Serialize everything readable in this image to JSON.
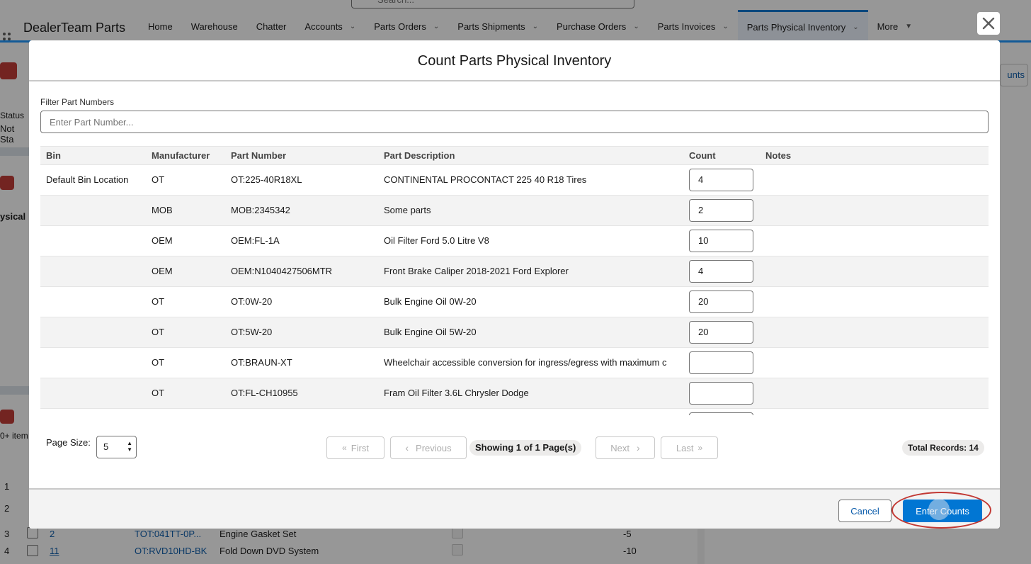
{
  "app": {
    "search_placeholder": "Search...",
    "name": "DealerTeam Parts",
    "nav": [
      {
        "label": "Home",
        "dropdown": false
      },
      {
        "label": "Warehouse",
        "dropdown": false
      },
      {
        "label": "Chatter",
        "dropdown": false
      },
      {
        "label": "Accounts",
        "dropdown": true
      },
      {
        "label": "Parts Orders",
        "dropdown": true
      },
      {
        "label": "Parts Shipments",
        "dropdown": true
      },
      {
        "label": "Purchase Orders",
        "dropdown": true
      },
      {
        "label": "Parts Invoices",
        "dropdown": true
      },
      {
        "label": "Parts Physical Inventory",
        "dropdown": true,
        "active": true
      },
      {
        "label": "More",
        "dropdown": true
      }
    ]
  },
  "background": {
    "status_label": "Status",
    "status_value": "Not Sta",
    "physical_label": "ysical",
    "items_label": "0+ item",
    "rows": [
      {
        "num": "1"
      },
      {
        "num": "2"
      },
      {
        "num": "3",
        "link": "2",
        "part": "TOT:041TT-0P...",
        "desc": "Engine Gasket Set",
        "qty": "-5"
      },
      {
        "num": "4",
        "link": "11",
        "part": "OT:RVD10HD-BK",
        "desc": "Fold Down DVD System",
        "qty": "-10"
      }
    ],
    "counts_btn": "unts"
  },
  "modal": {
    "title": "Count Parts Physical Inventory",
    "close_icon": "close-icon",
    "filter": {
      "label": "Filter Part Numbers",
      "placeholder": "Enter Part Number...",
      "value": ""
    },
    "columns": [
      "Bin",
      "Manufacturer",
      "Part Number",
      "Part Description",
      "Count",
      "Notes"
    ],
    "rows": [
      {
        "bin": "Default Bin Location",
        "manufacturer": "OT",
        "part_number": "OT:225-40R18XL",
        "description": "CONTINENTAL PROCONTACT 225 40 R18 Tires",
        "count": "4",
        "notes": ""
      },
      {
        "bin": "",
        "manufacturer": "MOB",
        "part_number": "MOB:2345342",
        "description": "Some parts",
        "count": "2",
        "notes": ""
      },
      {
        "bin": "",
        "manufacturer": "OEM",
        "part_number": "OEM:FL-1A",
        "description": "Oil Filter Ford 5.0 Litre V8",
        "count": "10",
        "notes": ""
      },
      {
        "bin": "",
        "manufacturer": "OEM",
        "part_number": "OEM:N1040427506MTR",
        "description": "Front Brake Caliper 2018-2021 Ford Explorer",
        "count": "4",
        "notes": ""
      },
      {
        "bin": "",
        "manufacturer": "OT",
        "part_number": "OT:0W-20",
        "description": "Bulk Engine Oil 0W-20",
        "count": "20",
        "notes": ""
      },
      {
        "bin": "",
        "manufacturer": "OT",
        "part_number": "OT:5W-20",
        "description": "Bulk Engine Oil 5W-20",
        "count": "20",
        "notes": ""
      },
      {
        "bin": "",
        "manufacturer": "OT",
        "part_number": "OT:BRAUN-XT",
        "description": "Wheelchair accessible conversion for ingress/egress with maximum c",
        "count": "",
        "notes": ""
      },
      {
        "bin": "",
        "manufacturer": "OT",
        "part_number": "OT:FL-CH10955",
        "description": "Fram Oil Filter 3.6L Chrysler Dodge",
        "count": "",
        "notes": ""
      }
    ],
    "pager": {
      "page_size_label": "Page Size:",
      "page_size": "5",
      "first": "First",
      "previous": "Previous",
      "next": "Next",
      "last": "Last",
      "showing": "Showing 1 of 1 Page(s)",
      "total": "Total Records: 14"
    },
    "footer": {
      "cancel": "Cancel",
      "enter_counts": "Enter Counts"
    }
  }
}
